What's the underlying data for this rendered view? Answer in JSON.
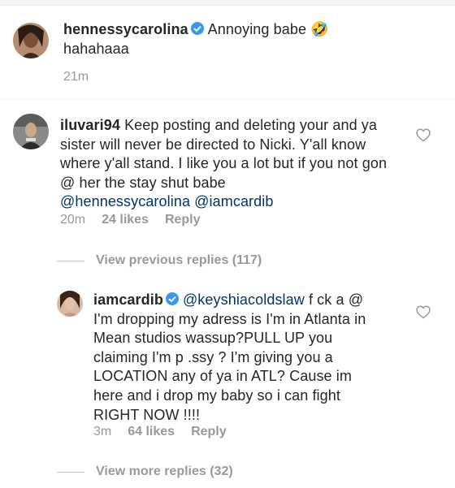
{
  "post": {
    "username": "hennessycarolina",
    "text": "Annoying babe",
    "emoji": "🤣",
    "text2": "hahahaaa",
    "time": "21m"
  },
  "comment": {
    "username": "iluvari94",
    "text": "Keep posting and deleting your and ya sister will never be directed to Nicki. Y'all know where y'all stand. I like you a lot but if you not gon @ her the stay shut babe",
    "mention1": "@hennessycarolina",
    "mention2": "@iamcardib",
    "time": "20m",
    "likes": "24 likes",
    "reply": "Reply"
  },
  "view_previous": "View previous replies (117)",
  "reply_comment": {
    "username": "iamcardib",
    "mention": "@keyshiacoldslaw",
    "line1_rest": "f ck a @",
    "lines": [
      "I'm dropping my adress is I'm in Atlanta in",
      "Mean studios wassup?PULL UP you",
      "claiming I'm p .ssy ? I'm giving you a",
      "LOCATION any of ya in ATL? Cause im",
      "here and i drop my baby so i can fight",
      "RIGHT NOW !!!!"
    ],
    "time": "3m",
    "likes": "64 likes",
    "reply": "Reply"
  },
  "view_more": "View more replies (32)",
  "icons": {
    "verified_color": "#3897f0",
    "heart": "heart-icon",
    "verified": "verified-badge-icon"
  }
}
